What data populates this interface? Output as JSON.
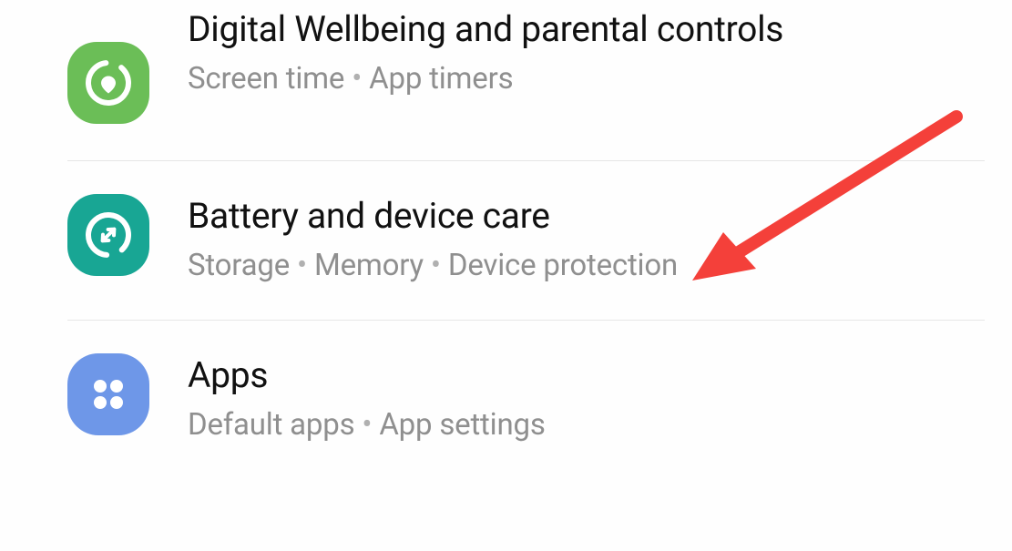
{
  "settings": {
    "items": [
      {
        "title": "Digital Wellbeing and parental controls",
        "sub1": "Screen time",
        "sub2": "App timers"
      },
      {
        "title": "Battery and device care",
        "sub1": "Storage",
        "sub2": "Memory",
        "sub3": "Device protection"
      },
      {
        "title": "Apps",
        "sub1": "Default apps",
        "sub2": "App settings"
      }
    ]
  },
  "annotation": {
    "arrow_color": "#F4403A"
  }
}
